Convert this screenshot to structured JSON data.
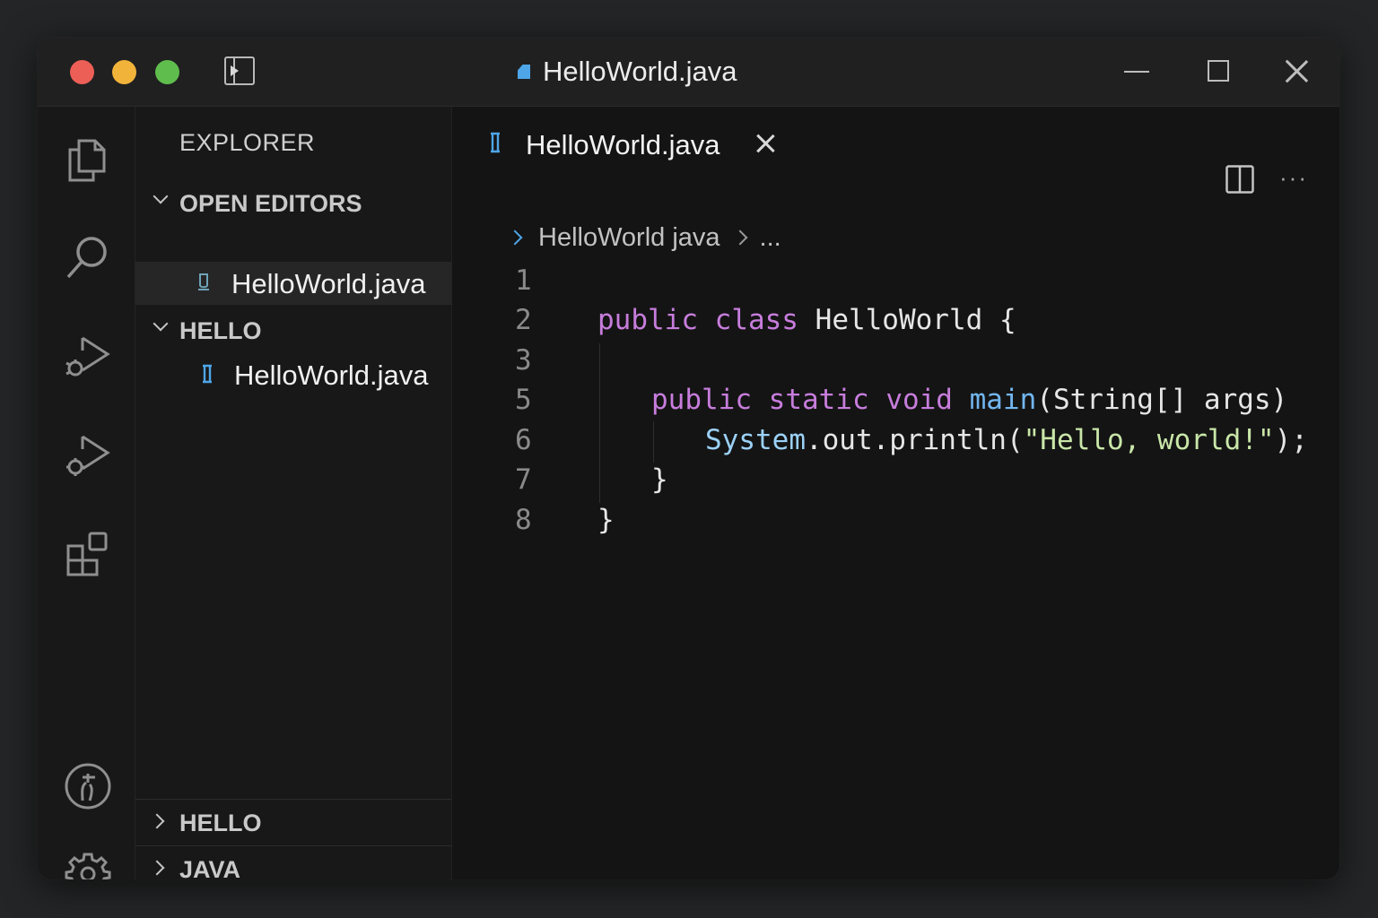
{
  "window": {
    "title": "HelloWorld.java",
    "colors": {
      "close": "#ec5f57",
      "minimize": "#f2b33b",
      "zoom": "#5fbd4d",
      "accent": "#4ea6e8"
    }
  },
  "activity_bar": {
    "icons": [
      "files-icon",
      "search-icon",
      "run-debug-icon",
      "run-extension-icon",
      "extensions-icon",
      "accounts-icon",
      "settings-gear-icon"
    ]
  },
  "sidebar": {
    "title": "EXPLORER",
    "open_editors": {
      "label": "OPEN EDITORS",
      "files": [
        {
          "name": "HelloWorld.java"
        }
      ]
    },
    "folder": {
      "label": "HELLO",
      "files": [
        {
          "name": "HelloWorld.java"
        }
      ]
    },
    "bottom_sections": [
      {
        "label": "HELLO"
      },
      {
        "label": "JAVA"
      }
    ]
  },
  "editor": {
    "tab": {
      "label": "HelloWorld.java"
    },
    "breadcrumb": {
      "file": "HelloWorld java",
      "more": "..."
    },
    "more_actions": "···",
    "line_numbers": [
      "1",
      "2",
      "3",
      "5",
      "6",
      "7",
      "8"
    ],
    "code": {
      "l2": {
        "kw1": "public",
        "kw2": "class",
        "name": "HelloWorld",
        "brace": "{"
      },
      "l5": {
        "kw1": "public",
        "kw2": "static",
        "kw3": "void",
        "fn": "main",
        "params": "(String[] args)"
      },
      "l6": {
        "cls": "System",
        "rest": ".out.println(",
        "str": "\"Hello, world!\"",
        "end": ");"
      },
      "l7": "}",
      "l8": "}"
    }
  }
}
